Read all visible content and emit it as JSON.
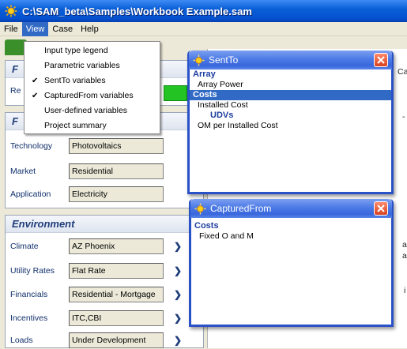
{
  "window": {
    "title": "C:\\SAM_beta\\Samples\\Workbook Example.sam"
  },
  "menubar": {
    "items": [
      "File",
      "View",
      "Case",
      "Help"
    ],
    "active_index": 1
  },
  "view_menu": {
    "items": [
      {
        "label": "Input type legend",
        "checked": false
      },
      {
        "label": "Parametric variables",
        "checked": false
      },
      {
        "label": "SentTo variables",
        "checked": true
      },
      {
        "label": "CapturedFrom variables",
        "checked": true
      },
      {
        "label": "User-defined variables",
        "checked": false
      },
      {
        "label": "Project summary",
        "checked": false
      }
    ]
  },
  "top_panel": {
    "header_initial": "F",
    "row_label_fragment": "Re"
  },
  "config_panel": {
    "header_initial": "F",
    "rows": [
      {
        "label": "Technology",
        "value": "Photovoltaics"
      },
      {
        "label": "Market",
        "value": "Residential"
      },
      {
        "label": "Application",
        "value": "Electricity"
      }
    ]
  },
  "environment_panel": {
    "title": "Environment",
    "rows": [
      {
        "label": "Climate",
        "value": "AZ Phoenix"
      },
      {
        "label": "Utility Rates",
        "value": "Flat Rate"
      },
      {
        "label": "Financials",
        "value": "Residential - Mortgage"
      },
      {
        "label": "Incentives",
        "value": "ITC,CBI"
      },
      {
        "label": "Loads",
        "value": "Under Development"
      }
    ]
  },
  "right_fragments": {
    "ca": "Ca",
    "dash": "-",
    "ase": "ase",
    "a": "a",
    "i": "i"
  },
  "sentto_window": {
    "title": "SentTo",
    "groups": [
      {
        "name": "Array",
        "items": [
          "Array Power"
        ],
        "selected": false
      },
      {
        "name": "Costs",
        "items": [
          "Installed Cost"
        ],
        "selected": true
      },
      {
        "name": "UDVs",
        "items": [
          "OM per Installed Cost"
        ],
        "selected": false
      }
    ]
  },
  "capturedfrom_window": {
    "title": "CapturedFrom",
    "groups": [
      {
        "name": "Costs",
        "items": [
          "Fixed O and M"
        ],
        "selected": false
      }
    ]
  },
  "colors": {
    "title_blue": "#0450cf",
    "selection": "#316ac5",
    "group_text": "#1c3fa0",
    "green": "#22c322"
  }
}
